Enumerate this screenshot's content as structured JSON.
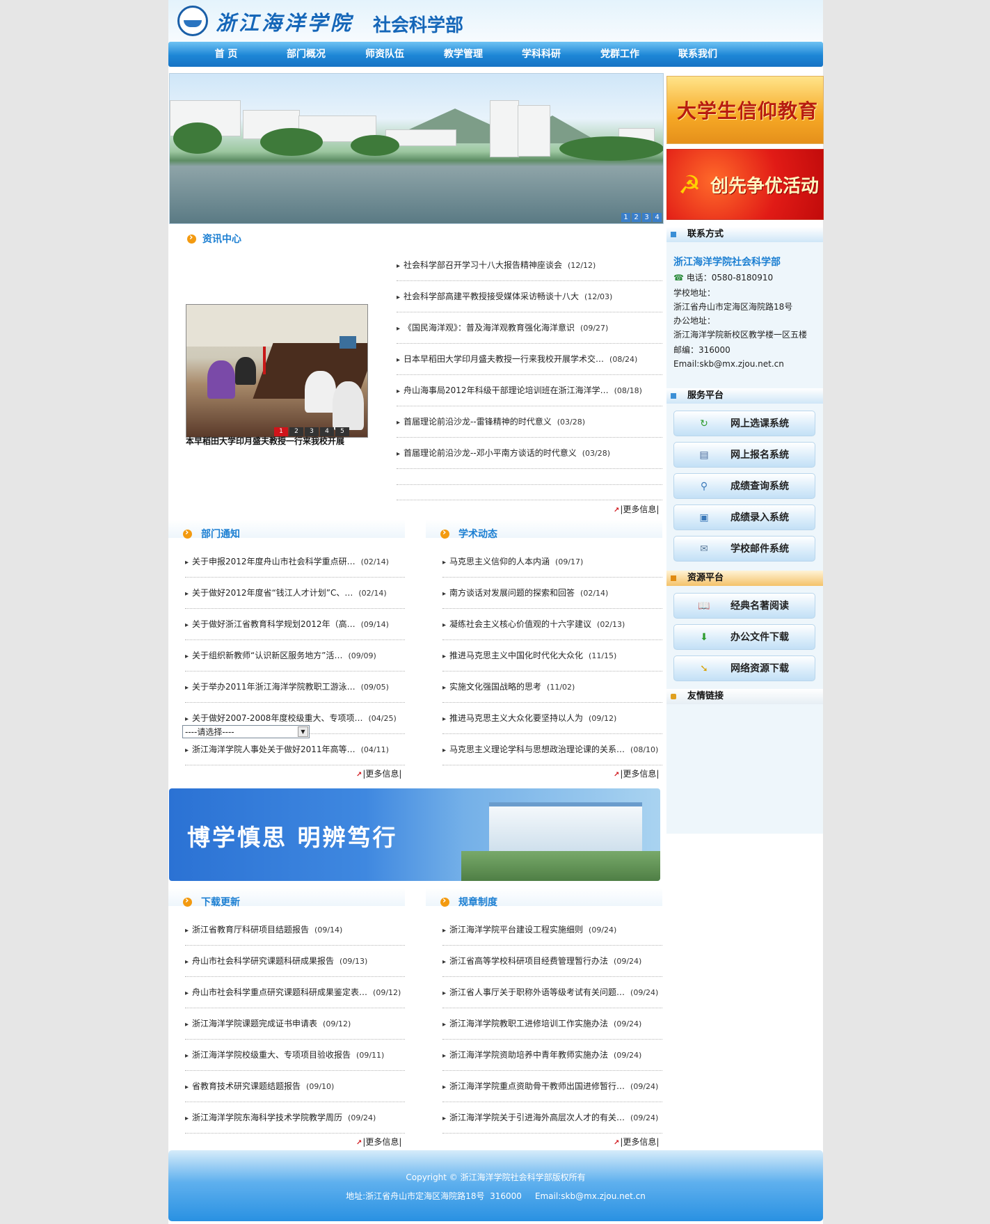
{
  "header": {
    "school_name": "浙江海洋学院",
    "dept_name": "社会科学部"
  },
  "nav": [
    {
      "label": "首  页"
    },
    {
      "label": "部门概况"
    },
    {
      "label": "师资队伍"
    },
    {
      "label": "教学管理"
    },
    {
      "label": "学科科研"
    },
    {
      "label": "党群工作"
    },
    {
      "label": "联系我们"
    }
  ],
  "banner": {
    "pages": [
      "1",
      "2",
      "3",
      "4"
    ]
  },
  "promos": {
    "promo1": "大学生信仰教育",
    "promo2": "创先争优活动"
  },
  "news": {
    "title": "资讯中心",
    "photo_caption": "本早稻田大学印月盛夫教授一行来我校开展",
    "photo_pages": [
      "1",
      "2",
      "3",
      "4",
      "5"
    ],
    "items": [
      {
        "text": "社会科学部召开学习十八大报告精神座谈会",
        "date": "(12/12)"
      },
      {
        "text": "社会科学部高建平教授接受媒体采访畅谈十八大",
        "date": "(12/03)"
      },
      {
        "text": "《国民海洋观》：普及海洋观教育强化海洋意识",
        "date": "(09/27)"
      },
      {
        "text": "日本早稻田大学印月盛夫教授一行来我校开展学术交…",
        "date": "(08/24)"
      },
      {
        "text": "舟山海事局2012年科级干部理论培训班在浙江海洋学…",
        "date": "(08/18)"
      },
      {
        "text": "首届理论前沿沙龙--雷锋精神的时代意义",
        "date": "(03/28)"
      },
      {
        "text": "首届理论前沿沙龙--邓小平南方谈话的时代意义",
        "date": "(03/28)"
      }
    ],
    "more": "|更多信息|"
  },
  "notices": {
    "title": "部门通知",
    "items": [
      {
        "text": "关于申报2012年度舟山市社会科学重点研…",
        "date": "(02/14)"
      },
      {
        "text": "关于做好2012年度省“钱江人才计划”C、…",
        "date": "(02/14)"
      },
      {
        "text": "关于做好浙江省教育科学规划2012年（高…",
        "date": "(09/14)"
      },
      {
        "text": "关于组织新教师“认识新区服务地方”活…",
        "date": "(09/09)"
      },
      {
        "text": "关于举办2011年浙江海洋学院教职工游泳…",
        "date": "(09/05)"
      },
      {
        "text": "关于做好2007-2008年度校级重大、专项项…",
        "date": "(04/25)"
      },
      {
        "text": "浙江海洋学院人事处关于做好2011年高等…",
        "date": "(04/11)"
      }
    ],
    "more": "|更多信息|"
  },
  "academic": {
    "title": "学术动态",
    "items": [
      {
        "text": "马克思主义信仰的人本内涵",
        "date": "(09/17)"
      },
      {
        "text": "南方谈话对发展问题的探索和回答",
        "date": "(02/14)"
      },
      {
        "text": "凝练社会主义核心价值观的十六字建议",
        "date": "(02/13)"
      },
      {
        "text": "推进马克思主义中国化时代化大众化",
        "date": "(11/15)"
      },
      {
        "text": "实施文化强国战略的思考",
        "date": "(11/02)"
      },
      {
        "text": "推进马克思主义大众化要坚持以人为",
        "date": "(09/12)"
      },
      {
        "text": "马克思主义理论学科与思想政治理论课的关系…",
        "date": "(08/10)"
      }
    ],
    "more": "|更多信息|"
  },
  "slogan": "博学慎思  明辨笃行",
  "downloads": {
    "title": "下载更新",
    "items": [
      {
        "text": "浙江省教育厅科研项目结题报告",
        "date": "(09/14)"
      },
      {
        "text": "舟山市社会科学研究课题科研成果报告",
        "date": "(09/13)"
      },
      {
        "text": "舟山市社会科学重点研究课题科研成果鉴定表…",
        "date": "(09/12)"
      },
      {
        "text": "浙江海洋学院课题完成证书申请表",
        "date": "(09/12)"
      },
      {
        "text": "浙江海洋学院校级重大、专项项目验收报告",
        "date": "(09/11)"
      },
      {
        "text": "省教育技术研究课题结题报告",
        "date": "(09/10)"
      },
      {
        "text": "浙江海洋学院东海科学技术学院教学周历",
        "date": "(09/24)"
      }
    ],
    "more": "|更多信息|"
  },
  "rules": {
    "title": "规章制度",
    "items": [
      {
        "text": "浙江海洋学院平台建设工程实施细则",
        "date": "(09/24)"
      },
      {
        "text": "浙江省高等学校科研项目经费管理暂行办法",
        "date": "(09/24)"
      },
      {
        "text": "浙江省人事厅关于职称外语等级考试有关问题…",
        "date": "(09/24)"
      },
      {
        "text": "浙江海洋学院教职工进修培训工作实施办法",
        "date": "(09/24)"
      },
      {
        "text": "浙江海洋学院资助培养中青年教师实施办法",
        "date": "(09/24)"
      },
      {
        "text": "浙江海洋学院重点资助骨干教师出国进修暂行…",
        "date": "(09/24)"
      },
      {
        "text": "浙江海洋学院关于引进海外高层次人才的有关…",
        "date": "(09/24)"
      }
    ],
    "more": "|更多信息|"
  },
  "contact": {
    "title": "联系方式",
    "name": "浙江海洋学院社会科学部",
    "phone": "电话：0580-8180910",
    "school_addr_label": "学校地址：",
    "school_addr": "浙江省舟山市定海区海院路18号",
    "office_addr_label": "办公地址：",
    "office_addr": "浙江海洋学院新校区教学楼一区五楼",
    "postcode": "邮编：316000",
    "email": "Email:skb@mx.zjou.net.cn"
  },
  "services": {
    "title": "服务平台",
    "items": [
      {
        "label": "网上选课系统",
        "icon": "refresh-icon"
      },
      {
        "label": "网上报名系统",
        "icon": "form-icon"
      },
      {
        "label": "成绩查询系统",
        "icon": "magnifier-icon"
      },
      {
        "label": "成绩录入系统",
        "icon": "monitor-icon"
      },
      {
        "label": "学校邮件系统",
        "icon": "mail-icon"
      }
    ]
  },
  "resources": {
    "title": "资源平台",
    "items": [
      {
        "label": "经典名著阅读",
        "icon": "book-icon"
      },
      {
        "label": "办公文件下载",
        "icon": "download-icon"
      },
      {
        "label": "网络资源下载",
        "icon": "arrow-icon"
      }
    ]
  },
  "links": {
    "title": "友情链接",
    "select_value": "----请选择----"
  },
  "footer": {
    "copyright": "Copyright © 浙江海洋学院社会科学部版权所有",
    "address": "地址:浙江省舟山市定海区海院路18号  316000     Email:skb@mx.zjou.net.cn"
  },
  "colors": {
    "brand_blue": "#1c7fd2",
    "nav_blue": "#1d86d6",
    "accent_orange": "#f39a10",
    "accent_red": "#d0141a"
  }
}
